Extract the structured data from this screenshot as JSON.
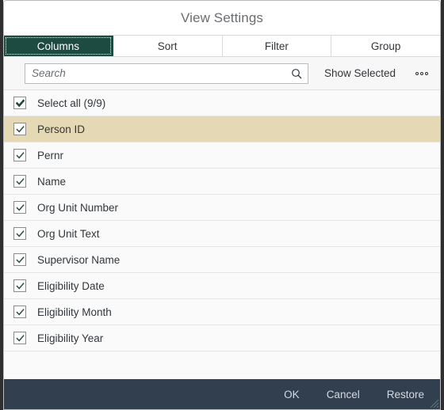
{
  "dialog": {
    "title": "View Settings"
  },
  "tabs": [
    {
      "label": "Columns",
      "selected": true
    },
    {
      "label": "Sort",
      "selected": false
    },
    {
      "label": "Filter",
      "selected": false
    },
    {
      "label": "Group",
      "selected": false
    }
  ],
  "toolbar": {
    "search_value": "",
    "search_placeholder": "Search",
    "search_icon": "search-icon",
    "show_selected_label": "Show Selected",
    "overflow_icon": "overflow-dots-icon"
  },
  "list": {
    "select_all": {
      "label": "Select all (9/9)",
      "checked": true,
      "highlighted": false
    },
    "items": [
      {
        "label": "Person ID",
        "checked": true,
        "highlighted": true
      },
      {
        "label": "Pernr",
        "checked": true,
        "highlighted": false
      },
      {
        "label": "Name",
        "checked": true,
        "highlighted": false
      },
      {
        "label": "Org Unit Number",
        "checked": true,
        "highlighted": false
      },
      {
        "label": "Org Unit Text",
        "checked": true,
        "highlighted": false
      },
      {
        "label": "Supervisor Name",
        "checked": true,
        "highlighted": false
      },
      {
        "label": "Eligibility Date",
        "checked": true,
        "highlighted": false
      },
      {
        "label": "Eligibility Month",
        "checked": true,
        "highlighted": false
      },
      {
        "label": "Eligibility Year",
        "checked": true,
        "highlighted": false
      }
    ]
  },
  "footer": {
    "ok_label": "OK",
    "cancel_label": "Cancel",
    "restore_label": "Restore"
  },
  "colors": {
    "accent_green": "#1d4b42",
    "highlight_row": "#e5d8b4",
    "footer_bg": "#313f4e",
    "footer_text": "#d3dbe4",
    "title_text": "#6a6d70"
  }
}
